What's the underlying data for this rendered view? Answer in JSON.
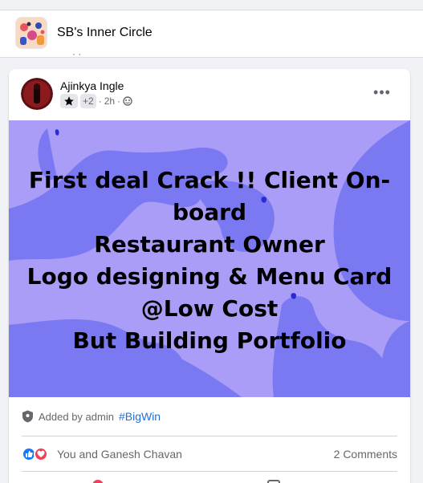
{
  "group": {
    "name": "SB's Inner Circle",
    "strip_text": "· ·"
  },
  "post": {
    "author": "Ajinkya Ingle",
    "badge_extra": "+2",
    "time": "2h",
    "separator": "·",
    "more_label": "•••",
    "image_lines": [
      "First deal Crack !! Client On-",
      "board",
      "Restaurant Owner",
      "Logo designing & Menu Card",
      "@Low Cost",
      "But Building Portfolio"
    ],
    "added_by": "Added by admin",
    "hashtag": "#BigWin",
    "reactions_text": "You and Ganesh Chavan",
    "comments_count": "2 Comments"
  },
  "colors": {
    "image_bg": "#a99df8",
    "image_shapes": "#7b79f2",
    "hashtag": "#216fdb",
    "like": "#1877f2",
    "love": "#f33e58"
  },
  "icons": [
    "group-avatar-illustration",
    "star-icon",
    "globe-icon",
    "more-icon",
    "shield-icon",
    "like-icon",
    "love-icon"
  ]
}
